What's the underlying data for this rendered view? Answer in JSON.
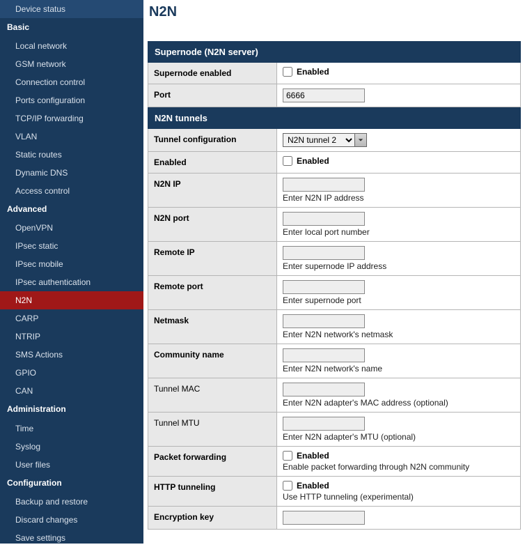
{
  "page": {
    "title": "N2N"
  },
  "sidebar": {
    "top_item": "Device status",
    "sections": [
      {
        "title": "Basic",
        "items": [
          "Local network",
          "GSM network",
          "Connection control",
          "Ports configuration",
          "TCP/IP forwarding",
          "VLAN",
          "Static routes",
          "Dynamic DNS",
          "Access control"
        ]
      },
      {
        "title": "Advanced",
        "items": [
          "OpenVPN",
          "IPsec static",
          "IPsec mobile",
          "IPsec authentication",
          "N2N",
          "CARP",
          "NTRIP",
          "SMS Actions",
          "GPIO",
          "CAN"
        ],
        "active": "N2N"
      },
      {
        "title": "Administration",
        "items": [
          "Time",
          "Syslog",
          "User files"
        ]
      },
      {
        "title": "Configuration",
        "items": [
          "Backup and restore",
          "Discard changes",
          "Save settings"
        ]
      }
    ]
  },
  "sections": {
    "supernode": {
      "header": "Supernode (N2N server)",
      "rows": {
        "supernode_enabled": {
          "label": "Supernode enabled",
          "cb_label": "Enabled",
          "checked": false
        },
        "port": {
          "label": "Port",
          "value": "6666"
        }
      }
    },
    "tunnels": {
      "header": "N2N tunnels",
      "rows": {
        "tunnel_conf": {
          "label": "Tunnel configuration",
          "selected": "N2N tunnel 2"
        },
        "enabled": {
          "label": "Enabled",
          "cb_label": "Enabled",
          "checked": false
        },
        "n2n_ip": {
          "label": "N2N IP",
          "hint": "Enter N2N IP address",
          "value": ""
        },
        "n2n_port": {
          "label": "N2N port",
          "hint": "Enter local port number",
          "value": ""
        },
        "remote_ip": {
          "label": "Remote IP",
          "hint": "Enter supernode IP address",
          "value": ""
        },
        "remote_port": {
          "label": "Remote port",
          "hint": "Enter supernode port",
          "value": ""
        },
        "netmask": {
          "label": "Netmask",
          "hint": "Enter N2N network's netmask",
          "value": ""
        },
        "community": {
          "label": "Community name",
          "hint": "Enter N2N network's name",
          "value": ""
        },
        "tunnel_mac": {
          "label": "Tunnel MAC",
          "hint": "Enter N2N adapter's MAC address (optional)",
          "value": "",
          "label_bold": false
        },
        "tunnel_mtu": {
          "label": "Tunnel MTU",
          "hint": "Enter N2N adapter's MTU (optional)",
          "value": "",
          "label_bold": false
        },
        "pkt_fwd": {
          "label": "Packet forwarding",
          "cb_label": "Enabled",
          "hint": "Enable packet forwarding through N2N community",
          "checked": false
        },
        "http_tun": {
          "label": "HTTP tunneling",
          "cb_label": "Enabled",
          "hint": "Use HTTP tunneling (experimental)",
          "checked": false
        },
        "enc_key": {
          "label": "Encryption key",
          "value": ""
        }
      }
    }
  }
}
